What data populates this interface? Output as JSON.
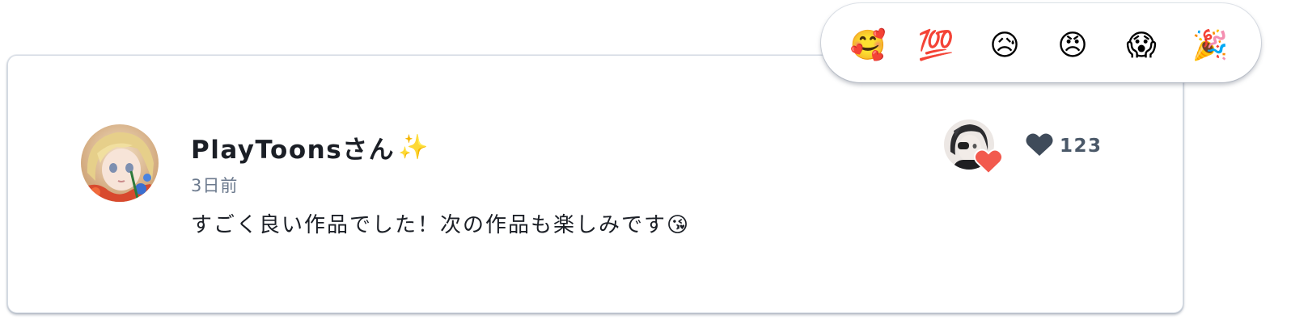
{
  "comment": {
    "author_name": "PlayToonsさん",
    "author_suffix_emoji": "✨",
    "timestamp": "3日前",
    "text": "すごく良い作品でした！次の作品も楽しみです😘",
    "like_count": "123"
  },
  "reactions": [
    {
      "name": "smiling-face-with-hearts",
      "glyph": "🥰"
    },
    {
      "name": "hundred-points",
      "glyph": "💯"
    },
    {
      "name": "sad-but-relieved-face",
      "glyph": "😥"
    },
    {
      "name": "angry-face",
      "glyph": "😠"
    },
    {
      "name": "face-screaming-in-fear",
      "glyph": "😱"
    },
    {
      "name": "party-popper",
      "glyph": "🎉"
    }
  ],
  "icons": {
    "like": "heart-icon",
    "creator_heart": "heart-icon"
  },
  "colors": {
    "heart_red": "#f25a4e",
    "like_icon": "#3f4b5a",
    "author_text": "#1b1f26",
    "muted_text": "#6c7a8e"
  }
}
